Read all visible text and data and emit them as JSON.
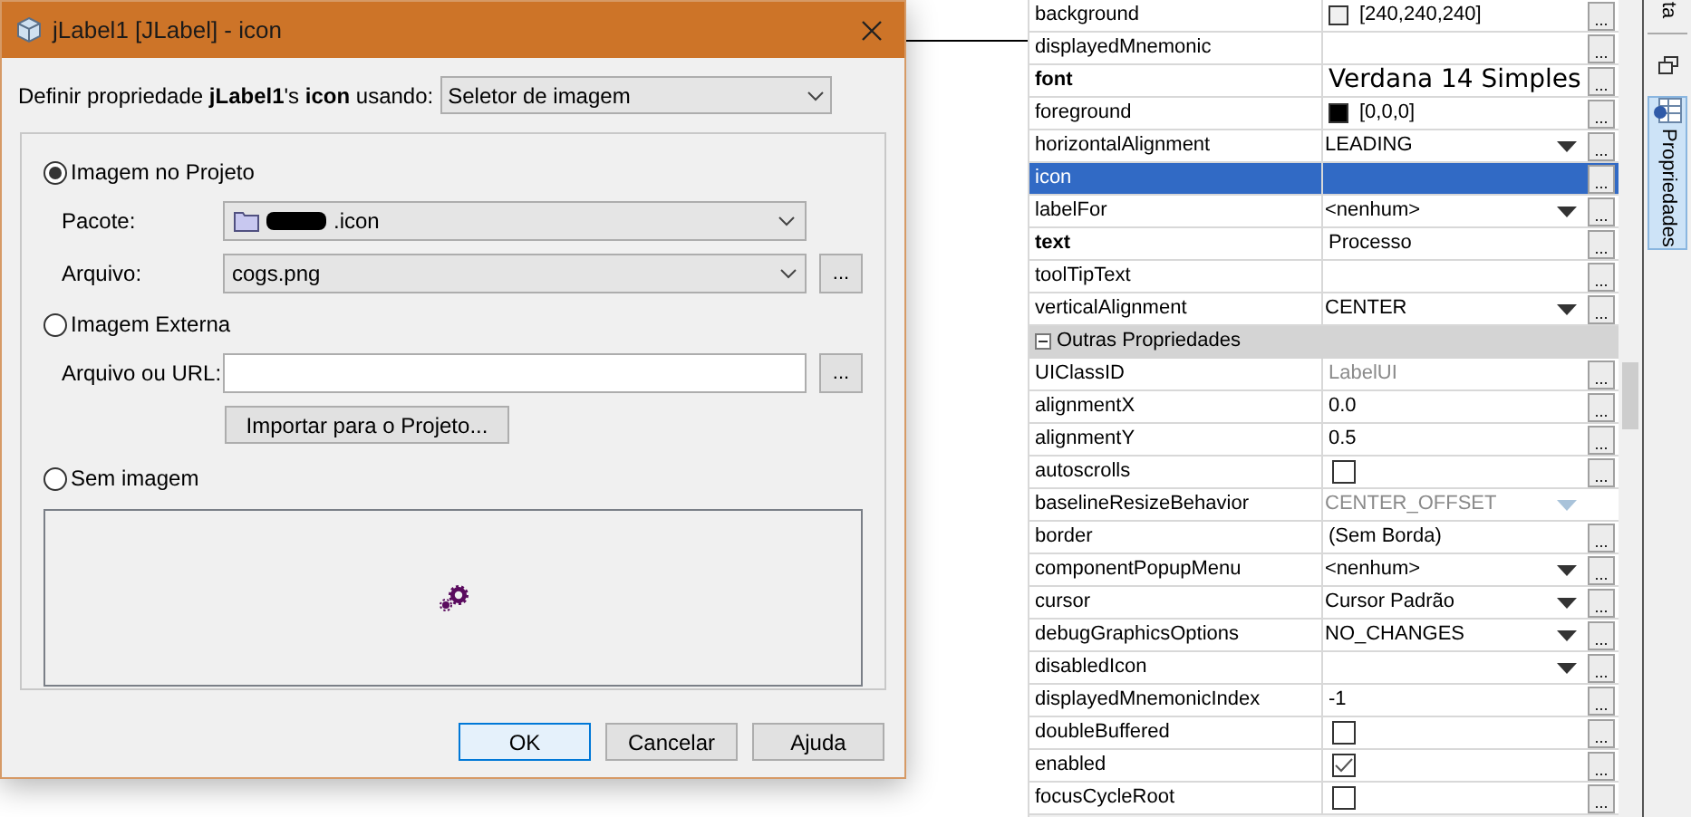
{
  "dialog": {
    "title": "jLabel1 [JLabel] - icon",
    "prompt": "Definir propriedade **jLabel1**'s **icon** usando:",
    "editor": "Seletor de imagem",
    "sources": [
      {
        "label": "Imagem no Projeto",
        "selected": true,
        "fields": [
          {
            "kind": "package",
            "label": "Pacote:",
            "value": ".icon"
          },
          {
            "kind": "combo",
            "label": "Arquivo:",
            "value": "cogs.png",
            "browse": "..."
          }
        ]
      },
      {
        "label": "Imagem Externa",
        "selected": false,
        "fields": [
          {
            "kind": "text",
            "label": "Arquivo ou URL:",
            "browse": "..."
          }
        ],
        "import_button": "Importar para o Projeto..."
      },
      {
        "label": "Sem imagem",
        "selected": false
      }
    ],
    "buttons": [
      {
        "label": "OK",
        "default": true
      },
      {
        "label": "Cancelar",
        "default": false
      },
      {
        "label": "Ajuda",
        "default": false
      }
    ]
  },
  "properties": [
    {
      "kind": "color",
      "name": "background",
      "value": "[240,240,240]",
      "color": "#f0f0f0",
      "bold": false,
      "selected": false,
      "button": "..."
    },
    {
      "kind": "text",
      "name": "displayedMnemonic",
      "bold": false,
      "selected": false,
      "button": "..."
    },
    {
      "kind": "font",
      "name": "font",
      "value": "Verdana 14 Simples",
      "bold": true,
      "selected": false,
      "button": "..."
    },
    {
      "kind": "color",
      "name": "foreground",
      "value": "[0,0,0]",
      "color": "#000000",
      "bold": false,
      "selected": false,
      "button": "..."
    },
    {
      "kind": "combo",
      "name": "horizontalAlignment",
      "value": "LEADING",
      "bold": false,
      "selected": false,
      "disabled": false,
      "button": "..."
    },
    {
      "kind": "text",
      "name": "icon",
      "bold": false,
      "selected": true,
      "button": "..."
    },
    {
      "kind": "combo",
      "name": "labelFor",
      "value": "<nenhum>",
      "bold": false,
      "selected": false,
      "disabled": false,
      "button": "..."
    },
    {
      "kind": "text",
      "name": "text",
      "value": "Processo",
      "bold": true,
      "selected": false,
      "disabled": false,
      "button": "..."
    },
    {
      "kind": "text",
      "name": "toolTipText",
      "bold": false,
      "selected": false,
      "button": "..."
    },
    {
      "kind": "combo",
      "name": "verticalAlignment",
      "value": "CENTER",
      "bold": false,
      "selected": false,
      "disabled": false,
      "button": "..."
    },
    {
      "kind": "section",
      "name": "Outras Propriedades",
      "expanded": true
    },
    {
      "kind": "text",
      "name": "UIClassID",
      "value": "LabelUI",
      "bold": false,
      "selected": false,
      "disabled": true,
      "button": "..."
    },
    {
      "kind": "text",
      "name": "alignmentX",
      "value": "0.0",
      "bold": false,
      "selected": false,
      "disabled": false,
      "button": "..."
    },
    {
      "kind": "text",
      "name": "alignmentY",
      "value": "0.5",
      "bold": false,
      "selected": false,
      "disabled": false,
      "button": "..."
    },
    {
      "kind": "check",
      "name": "autoscrolls",
      "checked": false,
      "bold": false,
      "selected": false,
      "button": "..."
    },
    {
      "kind": "combo",
      "name": "baselineResizeBehavior",
      "value": "CENTER_OFFSET",
      "bold": false,
      "selected": false,
      "disabled": true
    },
    {
      "kind": "text",
      "name": "border",
      "value": "(Sem Borda)",
      "bold": false,
      "selected": false,
      "disabled": false,
      "button": "..."
    },
    {
      "kind": "combo",
      "name": "componentPopupMenu",
      "value": "<nenhum>",
      "bold": false,
      "selected": false,
      "disabled": false,
      "button": "..."
    },
    {
      "kind": "combo",
      "name": "cursor",
      "value": "Cursor Padrão",
      "bold": false,
      "selected": false,
      "disabled": false,
      "button": "..."
    },
    {
      "kind": "combo",
      "name": "debugGraphicsOptions",
      "value": "NO_CHANGES",
      "bold": false,
      "selected": false,
      "disabled": false,
      "button": "..."
    },
    {
      "kind": "combo",
      "name": "disabledIcon",
      "bold": false,
      "selected": false,
      "button": "..."
    },
    {
      "kind": "text",
      "name": "displayedMnemonicIndex",
      "value": "-1",
      "bold": false,
      "selected": false,
      "disabled": false,
      "button": "..."
    },
    {
      "kind": "check",
      "name": "doubleBuffered",
      "checked": false,
      "bold": false,
      "selected": false,
      "button": "..."
    },
    {
      "kind": "check",
      "name": "enabled",
      "checked": true,
      "bold": false,
      "selected": false,
      "button": "..."
    },
    {
      "kind": "check",
      "name": "focusCycleRoot",
      "checked": false,
      "bold": false,
      "selected": false,
      "button": "..."
    }
  ],
  "side_tabs": [
    {
      "label": "ta",
      "selected": false
    },
    {
      "label": "Propriedades",
      "selected": true
    }
  ]
}
